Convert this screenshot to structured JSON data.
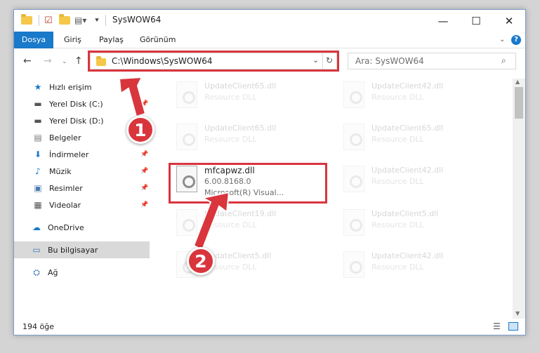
{
  "window": {
    "title": "SysWOW64",
    "controls": [
      "—",
      "☐",
      "✕"
    ]
  },
  "ribbon": {
    "tabs": [
      "Dosya",
      "Giriş",
      "Paylaş",
      "Görünüm"
    ]
  },
  "address": {
    "path": "C:\\Windows\\SysWOW64",
    "search_placeholder": "Ara: SysWOW64"
  },
  "sidebar": {
    "items": [
      {
        "label": "Hızlı erişim",
        "icon": "star-icon",
        "pinned": false
      },
      {
        "label": "Yerel Disk (C:)",
        "icon": "drive-icon",
        "pinned": true
      },
      {
        "label": "Yerel Disk (D:)",
        "icon": "drive-icon",
        "pinned": false
      },
      {
        "label": "Belgeler",
        "icon": "document-icon",
        "pinned": true
      },
      {
        "label": "İndirmeler",
        "icon": "download-icon",
        "pinned": true
      },
      {
        "label": "Müzik",
        "icon": "music-icon",
        "pinned": true
      },
      {
        "label": "Resimler",
        "icon": "picture-icon",
        "pinned": true
      },
      {
        "label": "Videolar",
        "icon": "video-icon",
        "pinned": true
      },
      {
        "label": "OneDrive",
        "icon": "cloud-icon",
        "pinned": false
      },
      {
        "label": "Bu bilgisayar",
        "icon": "computer-icon",
        "pinned": false
      },
      {
        "label": "Ağ",
        "icon": "network-icon",
        "pinned": false
      }
    ]
  },
  "files": {
    "highlighted": {
      "name": "mfcapwz.dll",
      "version": "6.00.8168.0",
      "company": "Microsoft(R) Visual..."
    },
    "background": [
      {
        "name": "UpdateClient65.dll",
        "desc": "Resource DLL"
      },
      {
        "name": "UpdateClient42.dll",
        "desc": "Resource DLL"
      },
      {
        "name": "UpdateClient65.dll",
        "desc": "Resource DLL"
      },
      {
        "name": "UpdateClient65.dll",
        "desc": "Resource DLL"
      },
      {
        "name": "UpdateClient42.dll",
        "desc": "Resource DLL"
      },
      {
        "name": "UpdateClient19.dll",
        "desc": "Resource DLL"
      },
      {
        "name": "UpdateClient5.dll",
        "desc": "Resource DLL"
      },
      {
        "name": "UpdateClient5.dll",
        "desc": "Resource DLL"
      },
      {
        "name": "UpdateClient42.dll",
        "desc": "Resource DLL"
      }
    ]
  },
  "status": {
    "count": "194 öğe"
  },
  "annotations": {
    "step1": "1",
    "step2": "2",
    "highlight_color": "#d9353d"
  }
}
